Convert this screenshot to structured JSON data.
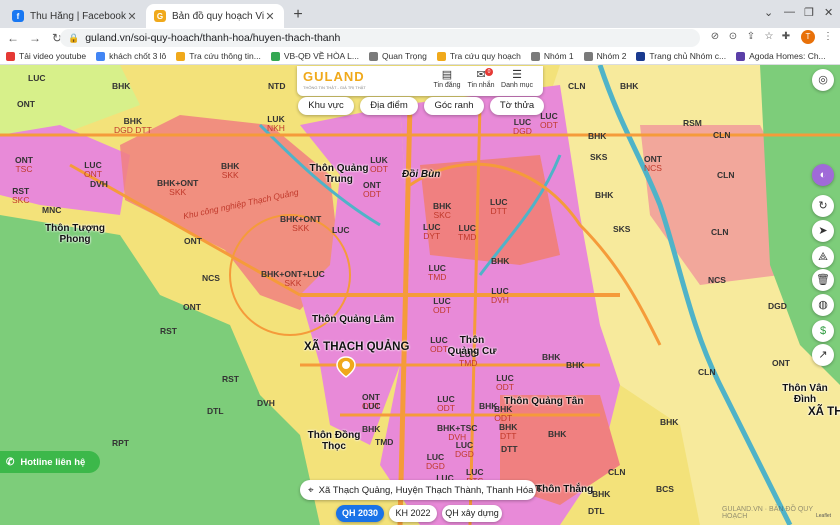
{
  "browser": {
    "tabs": [
      {
        "title": "Thu Hằng | Facebook",
        "icon": "facebook-icon",
        "color": "#1877f2",
        "active": false
      },
      {
        "title": "Bản đồ quy hoạch Việt Nam, tỉ",
        "icon": "guland-icon",
        "color": "#f0a91b",
        "active": true
      }
    ],
    "new_tab": "+",
    "url": "guland.vn/soi-quy-hoach/thanh-hoa/huyen-thach-thanh",
    "profile_initial": "T",
    "bookmarks": [
      {
        "label": "Tải video youtube",
        "color": "#e53935"
      },
      {
        "label": "khách chốt 3 lô",
        "color": "#4285f4"
      },
      {
        "label": "Tra cứu thông tin...",
        "color": "#f0a91b"
      },
      {
        "label": "VB-QĐ VỀ HÒA L...",
        "color": "#34a853"
      },
      {
        "label": "Quan Trọng",
        "color": "#7a7a7a"
      },
      {
        "label": "Tra cứu quy hoạch",
        "color": "#f0a91b"
      },
      {
        "label": "Nhóm 1",
        "color": "#7a7a7a"
      },
      {
        "label": "Nhóm 2",
        "color": "#7a7a7a"
      },
      {
        "label": "Trang chủ Nhóm c...",
        "color": "#1a3a8f"
      },
      {
        "label": "Agoda Homes: Ch...",
        "color": "#5b3fa8"
      }
    ]
  },
  "site": {
    "logo": "GULAND",
    "tagline": "THÔNG TIN THẬT - GIÁ TRỊ THẬT",
    "header_buttons": [
      {
        "label": "Tin đăng",
        "icon": "news-icon"
      },
      {
        "label": "Tin nhắn",
        "icon": "message-icon",
        "badge": "0"
      },
      {
        "label": "Danh mục",
        "icon": "menu-icon"
      }
    ],
    "filter_pills": [
      "Khu vực",
      "Địa điểm",
      "Góc ranh",
      "Tờ thửa"
    ],
    "hotline": "Hotline liên hệ",
    "address": "Xã Thạch Quảng, Huyện Thạch Thành, Thanh Hóa",
    "bottom_tabs": [
      {
        "label": "QH 2030",
        "active": true
      },
      {
        "label": "KH 2022",
        "active": false
      },
      {
        "label": "QH xây dựng",
        "active": false
      }
    ],
    "watermark": "GULAND.VN · BẢN ĐỒ QUY HOẠCH",
    "attribution": "Leaflet"
  },
  "map": {
    "colors": {
      "agri": "#f3e27a",
      "forest": "#7dcd7a",
      "residential": "#e88ad8",
      "urban": "#f08080",
      "industrial": "#f2a79b",
      "road": "#f59b3a",
      "river": "#4fb3c8",
      "cln": "#d7f08a",
      "bhk": "#f7ea9c"
    },
    "places": [
      {
        "name": "Thôn Quảng Trung",
        "big": false
      },
      {
        "name": "Đồi Bùn",
        "big": false
      },
      {
        "name": "Thôn Tượng Phong",
        "big": false
      },
      {
        "name": "Thôn Quảng Lâm",
        "big": false
      },
      {
        "name": "XÃ THẠCH QUẢNG",
        "big": true
      },
      {
        "name": "Thôn Quảng Cư",
        "big": false
      },
      {
        "name": "Thôn Quảng Tân",
        "big": false
      },
      {
        "name": "Thôn Đồng Thọc",
        "big": false
      },
      {
        "name": "Thôn Vân Đình",
        "big": false
      },
      {
        "name": "XÃ TH",
        "big": true
      },
      {
        "name": "Thôn Thắng",
        "big": false
      }
    ],
    "zone_label": "Khu công nghiệp Thạch Quảng",
    "labels": [
      [
        "LUC",
        ""
      ],
      [
        "BHK",
        ""
      ],
      [
        "ONT",
        ""
      ],
      [
        "NTD",
        ""
      ],
      [
        "LUC",
        ""
      ],
      [
        "CLN",
        ""
      ],
      [
        "BHK",
        ""
      ],
      [
        "LUC",
        "ODT"
      ],
      [
        "BHK",
        "DGD DTT"
      ],
      [
        "LUK",
        "NKH"
      ],
      [
        "LUC",
        "DGD"
      ],
      [
        "BHK",
        ""
      ],
      [
        "CLN",
        ""
      ],
      [
        "RSM",
        ""
      ],
      [
        "ONT",
        "TSC"
      ],
      [
        "LUC",
        "ONT"
      ],
      [
        "DVH",
        ""
      ],
      [
        "BHK",
        "SKK"
      ],
      [
        "LUK",
        "ODT"
      ],
      [
        "ONT",
        "ODT"
      ],
      [
        "SKS",
        ""
      ],
      [
        "ONT",
        "NCS"
      ],
      [
        "RST",
        "SKC"
      ],
      [
        "BHK+ONT",
        "SKK"
      ],
      [
        "BHK",
        "SKC"
      ],
      [
        "LUC",
        "DTT"
      ],
      [
        "BHK",
        ""
      ],
      [
        "CLN",
        ""
      ],
      [
        "MNC",
        ""
      ],
      [
        "BHK+ONT",
        "SKK"
      ],
      [
        "LUC",
        ""
      ],
      [
        "LUC",
        "DYT"
      ],
      [
        "LUC",
        "TMD"
      ],
      [
        "SKS",
        ""
      ],
      [
        "CLN",
        ""
      ],
      [
        "ONT",
        ""
      ],
      [
        "BHK+ONT+LUC",
        "SKK"
      ],
      [
        "LUC",
        "TMD"
      ],
      [
        "BHK",
        ""
      ],
      [
        "NCS",
        ""
      ],
      [
        "ONT",
        ""
      ],
      [
        "NCS",
        ""
      ],
      [
        "LUC",
        "ODT"
      ],
      [
        "LUC",
        "DVH"
      ],
      [
        "DGD",
        ""
      ],
      [
        "RST",
        ""
      ],
      [
        "LUC",
        "ODT"
      ],
      [
        "LUC",
        "TMD"
      ],
      [
        "ONT",
        ""
      ],
      [
        "ONT",
        "ODT"
      ],
      [
        "LUC",
        "ODT"
      ],
      [
        "BHK",
        ""
      ],
      [
        "BHK",
        ""
      ],
      [
        "RST",
        ""
      ],
      [
        "LUC",
        "ODT"
      ],
      [
        "BHK",
        "ODT"
      ],
      [
        "CLN",
        ""
      ],
      [
        "BHK",
        ""
      ],
      [
        "DTL",
        ""
      ],
      [
        "DVH",
        ""
      ],
      [
        "BHK+TSC",
        "DVH"
      ],
      [
        "BHK",
        ""
      ],
      [
        "LUC",
        ""
      ],
      [
        "BHK",
        ""
      ],
      [
        "LUC",
        "DGD"
      ],
      [
        "DTT",
        ""
      ],
      [
        "BHK",
        ""
      ],
      [
        "RPT",
        ""
      ],
      [
        "TMD",
        ""
      ],
      [
        "LUC",
        "DGD"
      ],
      [
        "BHK",
        "DTT"
      ],
      [
        "CLN",
        ""
      ],
      [
        "LUC",
        "CAN"
      ],
      [
        "LUC",
        "DTS"
      ],
      [
        "BHK",
        ""
      ],
      [
        "BHK",
        ""
      ],
      [
        "DTL",
        ""
      ],
      [
        "BCS",
        ""
      ]
    ]
  }
}
